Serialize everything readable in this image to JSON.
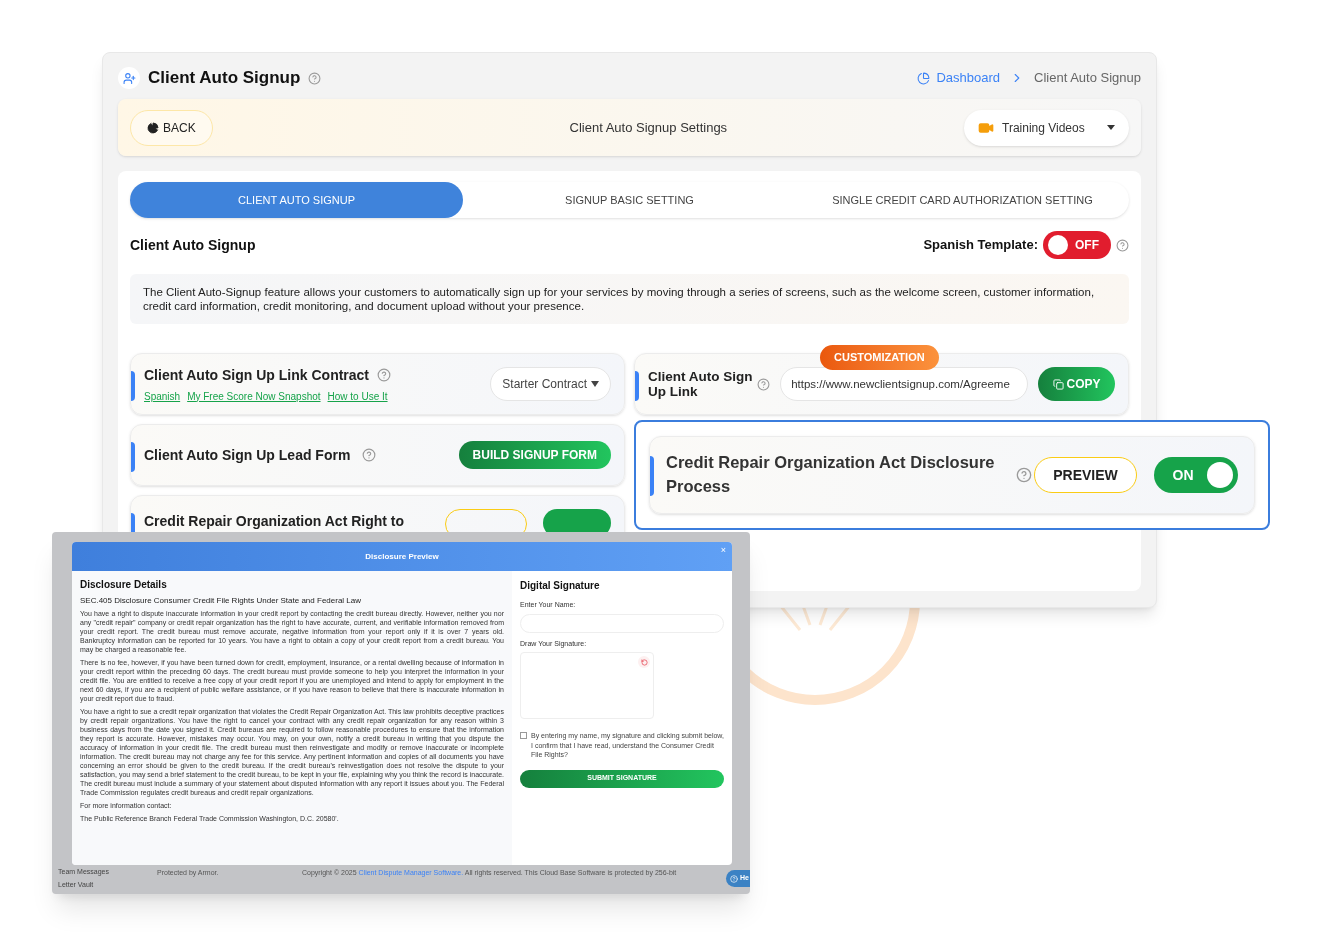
{
  "header": {
    "title": "Client Auto Signup",
    "breadcrumb": [
      {
        "label": "Dashboard",
        "kind": "link"
      },
      {
        "label": "Client Auto Signup",
        "kind": "current"
      }
    ]
  },
  "toolbar": {
    "back": "BACK",
    "title": "Client Auto Signup Settings",
    "training": "Training Videos"
  },
  "tabs": [
    {
      "label": "CLIENT AUTO SIGNUP",
      "selected": true
    },
    {
      "label": "SIGNUP BASIC SETTING",
      "selected": false
    },
    {
      "label": "SINGLE CREDIT CARD AUTHORIZATION SETTING",
      "selected": false
    }
  ],
  "section": {
    "title": "Client Auto Signup",
    "spanish_template": {
      "label": "Spanish Template:",
      "on": false,
      "state_text": "OFF"
    },
    "description": "The Client Auto-Signup feature allows your customers to automatically sign up for your services by moving through a series of screens, such as the welcome screen, customer information, credit card information, credit monitoring, and document upload without your presence."
  },
  "customization_badge": "CUSTOMIZATION",
  "left_rows": [
    {
      "kind": "contract",
      "title": "Client Auto Sign Up Link Contract",
      "links": [
        "Spanish",
        "My Free Score Now Snapshot",
        "How to Use It"
      ],
      "select": "Starter Contract"
    },
    {
      "kind": "button",
      "title": "Client Auto Sign Up Lead Form",
      "button": "BUILD SIGNUP FORM"
    },
    {
      "kind": "toggle",
      "title": "Credit Repair Organization Act Right to"
    }
  ],
  "link_row": {
    "title": "Client Auto Sign Up Link",
    "url": "https://www.newclientsignup.com/Agreeme",
    "button": "COPY"
  },
  "highlight": {
    "title": "Credit Repair Organization Act Disclosure Process",
    "preview": "PREVIEW",
    "on": true,
    "state_text": "ON"
  },
  "preview_window": {
    "backdrop": {
      "sidebar": [
        "Team Messages",
        "Letter Vault"
      ],
      "footer_left": "Protected by Armor.",
      "copyright": "Copyright © 2025",
      "copyright_link": "Client Dispute Manager Software.",
      "copyright_rest": "All rights reserved. This Cloud Base Software is protected by 256-bit",
      "help": "He"
    },
    "title": "Disclosure Preview",
    "close": "×",
    "details_title": "Disclosure Details",
    "law_title": "SEC.405 Disclosure Consumer Credit File Rights Under State and Federal Law",
    "paragraphs": [
      "You have a right to dispute inaccurate information in your credit report by contacting the credit bureau directly. However, neither you nor any \"credit repair\" company or credit repair organization has the right to have accurate, current, and verifiable information removed from your credit report. The credit bureau must remove accurate, negative information from your report only if it is over 7 years old. Bankruptcy information can be reported for 10 years. You have a right to obtain a copy of your credit report from a credit bureau. You may be charged a reasonable fee.",
      "There is no fee, however, if you have been turned down for credit, employment, insurance, or a rental dwelling because of information in your credit report within the preceding 60 days. The credit bureau must provide someone to help you interpret the information in your credit file. You are entitled to receive a free copy of your credit report if you are unemployed and intend to apply for employment in the next 60 days, if you are a recipient of public welfare assistance, or if you have reason to believe that there is inaccurate information in your credit report due to fraud.",
      "You have a right to sue a credit repair organization that violates the Credit Repair Organization Act. This law prohibits deceptive practices by credit repair organizations. You have the right to cancel your contract with any credit repair organization for any reason within 3 business days from the date you signed it. Credit bureaus are required to follow reasonable procedures to ensure that the information they report is accurate. However, mistakes may occur. You may, on your own, notify a credit bureau in writing that you dispute the accuracy of information in your credit file. The credit bureau must then reinvestigate and modify or remove inaccurate or incomplete information. The credit bureau may not charge any fee for this service. Any pertinent information and copies of all documents you have concerning an error should be given to the credit bureau. If the credit bureau's reinvestigation does not resolve the dispute to your satisfaction, you may send a brief statement to the credit bureau, to be kept in your file, explaining why you think the record is inaccurate. The credit bureau must include a summary of your statement about disputed information with any report it issues about you. The Federal Trade Commission regulates credit bureaus and credit repair organizations.",
      "For more information contact:",
      "The Public Reference Branch Federal Trade Commission Washington, D.C. 20580'."
    ],
    "signature": {
      "title": "Digital Signature",
      "name_label": "Enter Your Name:",
      "draw_label": "Draw Your Signature:",
      "agree": "By entering my name, my signature and clicking submit below, I confirm that I have read, understand the Consumer Credit File Rights?",
      "checked": false,
      "submit": "SUBMIT SIGNATURE"
    }
  }
}
